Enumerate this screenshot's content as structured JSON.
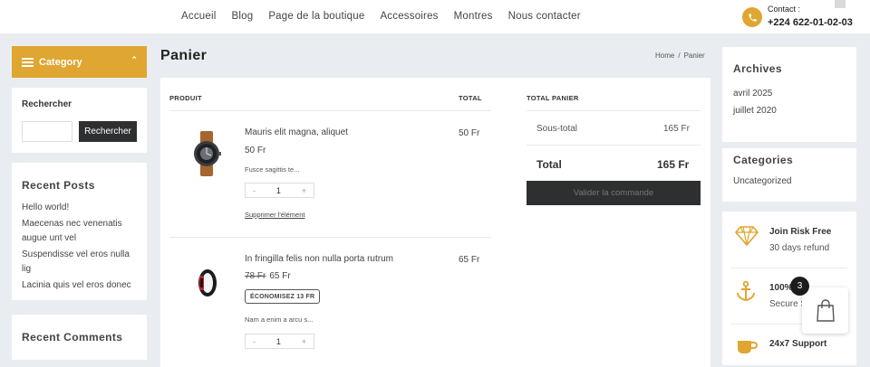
{
  "nav": {
    "items": [
      "Accueil",
      "Blog",
      "Page de la boutique",
      "Accessoires",
      "Montres",
      "Nous contacter"
    ]
  },
  "contact": {
    "label": "Contact :",
    "phone": "+224 622-01-02-03"
  },
  "sidebar_left": {
    "category_label": "Category",
    "search_title": "Rechercher",
    "search_button": "Rechercher",
    "search_placeholder": "",
    "recent_posts_title": "Recent Posts",
    "recent_posts": [
      "Hello world!",
      "Maecenas nec venenatis augue unt vel",
      "Suspendisse vel eros nulla lig",
      "Lacinia quis vel eros donec"
    ],
    "recent_comments_title": "Recent Comments"
  },
  "page": {
    "title": "Panier",
    "breadcrumb": [
      "Home",
      "Panier"
    ]
  },
  "cart": {
    "headers": {
      "product": "PRODUIT",
      "total": "TOTAL"
    },
    "items": [
      {
        "name": "Mauris elit magna, aliquet",
        "price": "50 Fr",
        "old_price": "",
        "description": "Fusce sagittis te...",
        "quantity": "1",
        "total": "50 Fr",
        "remove_label": "Supprimer l'élément",
        "badge": ""
      },
      {
        "name": "In fringilla felis non nulla porta rutrum",
        "price": "65 Fr",
        "old_price": "78 Fr",
        "description": "Nam a enim a arcu s...",
        "quantity": "1",
        "total": "65 Fr",
        "remove_label": "",
        "badge": "ÉCONOMISEZ 13 FR"
      }
    ],
    "qty_minus": "-",
    "qty_plus": "+"
  },
  "totals": {
    "title": "TOTAL PANIER",
    "subtotal_label": "Sous-total",
    "subtotal_value": "165 Fr",
    "total_label": "Total",
    "total_value": "165 Fr",
    "checkout_button": "Valider la commande"
  },
  "sidebar_right": {
    "archives_title": "Archives",
    "archives": [
      "avril 2025",
      "juillet 2020"
    ],
    "categories_title": "Categories",
    "categories": [
      "Uncategorized"
    ],
    "features": [
      {
        "icon": "diamond-icon",
        "title": "Join Risk Free",
        "subtitle": "30 days refund"
      },
      {
        "icon": "anchor-icon",
        "title": "100%",
        "subtitle": "Secure S"
      },
      {
        "icon": "coffee-cup-icon",
        "title": "24x7 Support",
        "subtitle": ""
      }
    ]
  },
  "cart_float": {
    "count": "3"
  },
  "colors": {
    "accent": "#dfa631",
    "dark_button": "#2d2f31",
    "background": "#e9edf1"
  }
}
